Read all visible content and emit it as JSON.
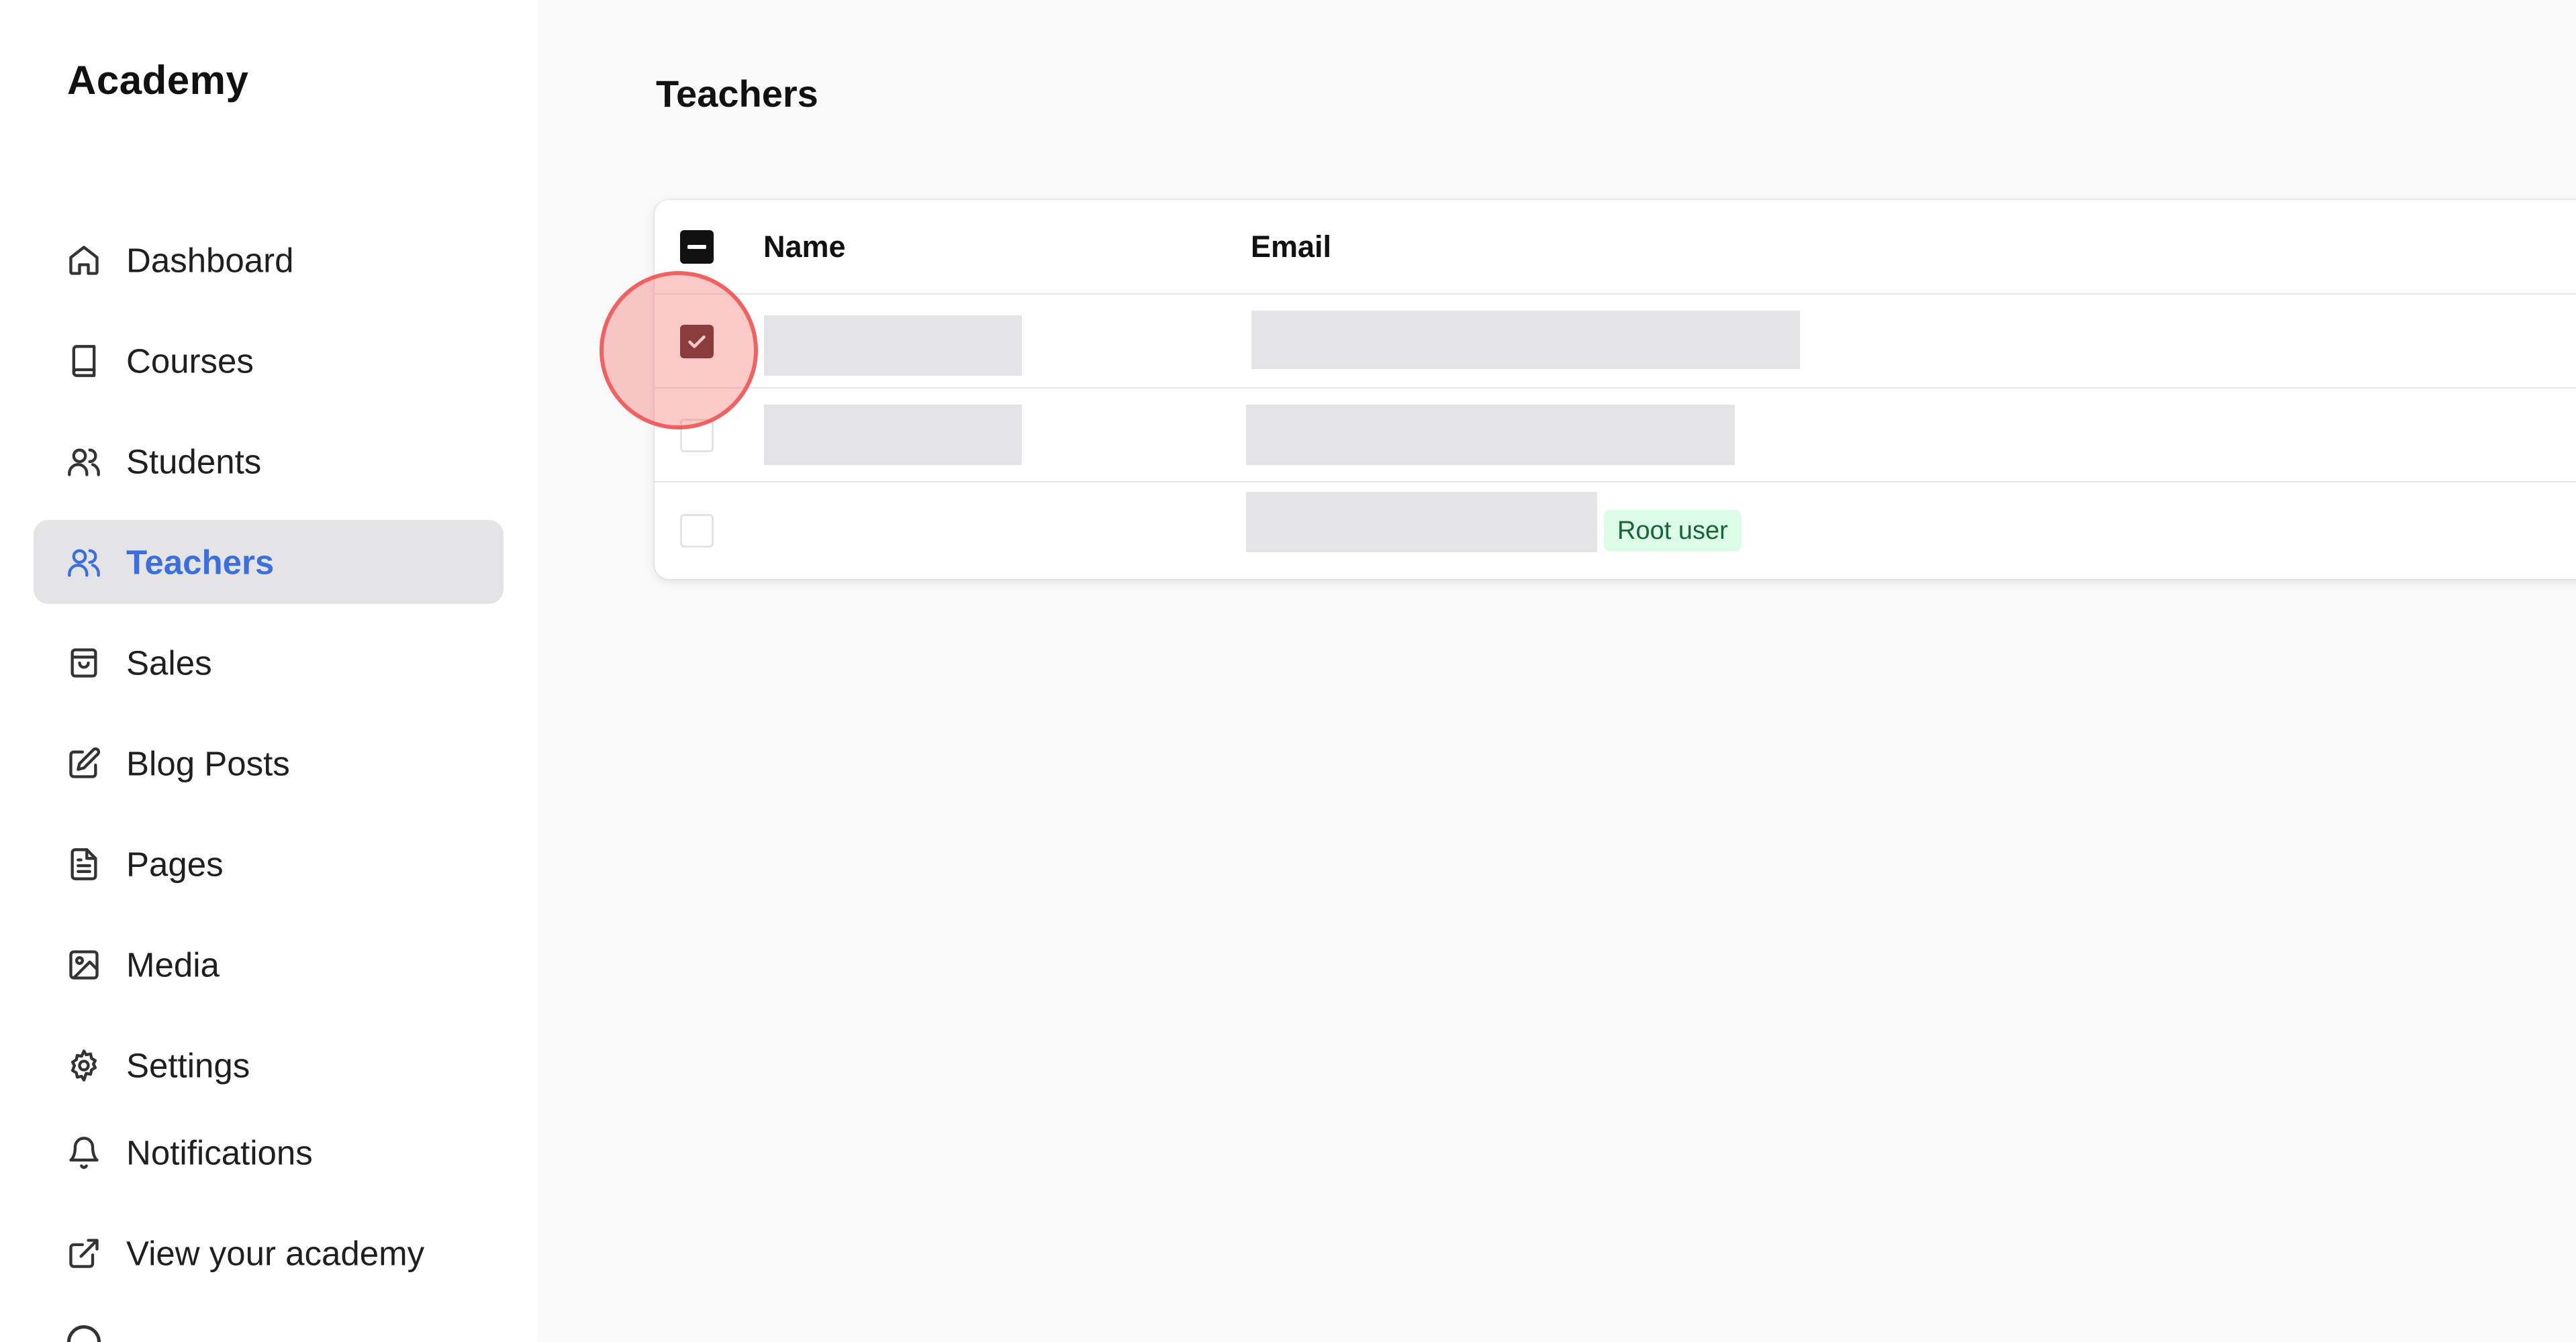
{
  "sidebar": {
    "brand": "Academy",
    "items": [
      {
        "label": "Dashboard",
        "icon": "home-icon"
      },
      {
        "label": "Courses",
        "icon": "book-icon"
      },
      {
        "label": "Students",
        "icon": "users-icon"
      },
      {
        "label": "Teachers",
        "icon": "users-icon",
        "active": true
      },
      {
        "label": "Sales",
        "icon": "shopping-bag-icon"
      },
      {
        "label": "Blog Posts",
        "icon": "edit-icon"
      },
      {
        "label": "Pages",
        "icon": "file-text-icon"
      },
      {
        "label": "Media",
        "icon": "image-icon"
      },
      {
        "label": "Settings",
        "icon": "gear-icon"
      },
      {
        "label": "Notifications",
        "icon": "bell-icon"
      },
      {
        "label": "View your academy",
        "icon": "external-link-icon"
      }
    ]
  },
  "main": {
    "title": "Teachers",
    "table": {
      "columns": [
        "Name",
        "Email"
      ],
      "header_checkbox": "indeterminate",
      "rows": [
        {
          "checked": true,
          "badge": ""
        },
        {
          "checked": false,
          "badge": ""
        },
        {
          "checked": false,
          "badge": "Root user"
        }
      ]
    }
  },
  "colors": {
    "accent": "#3b6fe0",
    "active_bg": "#e4e4e7",
    "checkbox_checked": "#4a1c1c",
    "badge_bg": "#dcfce7",
    "badge_text": "#166534",
    "click_indicator": "#ef4444"
  }
}
